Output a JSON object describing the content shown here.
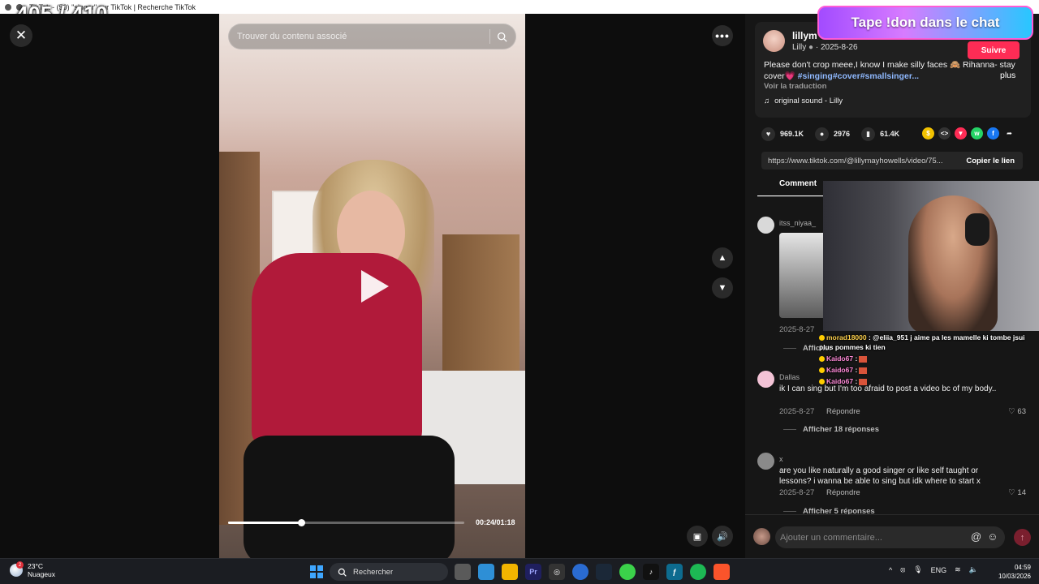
{
  "window": {
    "title": "TikTok - (50) \"singer\" sur TikTok | Recherche TikTok",
    "counter": "405 / 410"
  },
  "player": {
    "search_placeholder": "Trouver du contenu associé",
    "time": "00:24/01:18",
    "progress": 0.31
  },
  "post": {
    "username": "lillym",
    "display_name": "Lilly",
    "date": "2025-8-26",
    "follow_label": "Suivre",
    "description": "Please don't crop meee,I know I make silly faces 🙈 Rihanna- stay cover💗 ",
    "hashtags": "#singing#cover#smallsinger...",
    "more_label": "plus",
    "translate_label": "Voir la traduction",
    "sound": "original sound - Lilly"
  },
  "actions": {
    "likes": "969.1K",
    "comments": "2976",
    "saves": "61.4K"
  },
  "link": {
    "url": "https://www.tiktok.com/@lillymayhowells/video/75...",
    "copy_label": "Copier le lien"
  },
  "tabs": {
    "comments": "Comment"
  },
  "comments": [
    {
      "user": "itss_niyaa_",
      "date": "2025-8-27",
      "replies": "Afficher"
    },
    {
      "user": "Dallas",
      "text": "ik I can sing but I'm too afraid to post a video bc of my body..",
      "date": "2025-8-27",
      "reply_label": "Répondre",
      "likes": "63",
      "replies": "Afficher 18 réponses"
    },
    {
      "user": "x",
      "text": "are you like naturally a good singer or like self taught or lessons? i wanna be able to sing but idk where to start x",
      "date": "2025-8-27",
      "reply_label": "Répondre",
      "likes": "14",
      "replies": "Afficher 5 réponses"
    }
  ],
  "comment_input": {
    "placeholder": "Ajouter un commentaire..."
  },
  "overlay": {
    "banner": "Tape !don dans le chat",
    "chat": [
      {
        "name": "morad18000",
        "message": " : @eliia_951 j aime pa les mamelle ki tombe jsui plus pommes ki tien"
      },
      {
        "name": "Kaido67",
        "message": " :"
      },
      {
        "name": "Kaido67",
        "message": " :"
      },
      {
        "name": "Kaido67",
        "message": " :"
      }
    ]
  },
  "taskbar": {
    "temperature": "23°C",
    "weather": "Nuageux",
    "weather_badge": "2",
    "search_label": "Rechercher",
    "language": "ENG",
    "time": "04:59",
    "date": "10/03/2026"
  },
  "colors": {
    "accent": "#fe2c55",
    "hashtag": "#8fb9ff",
    "panel": "#161616",
    "windows_blue": "#3ea6ff"
  }
}
